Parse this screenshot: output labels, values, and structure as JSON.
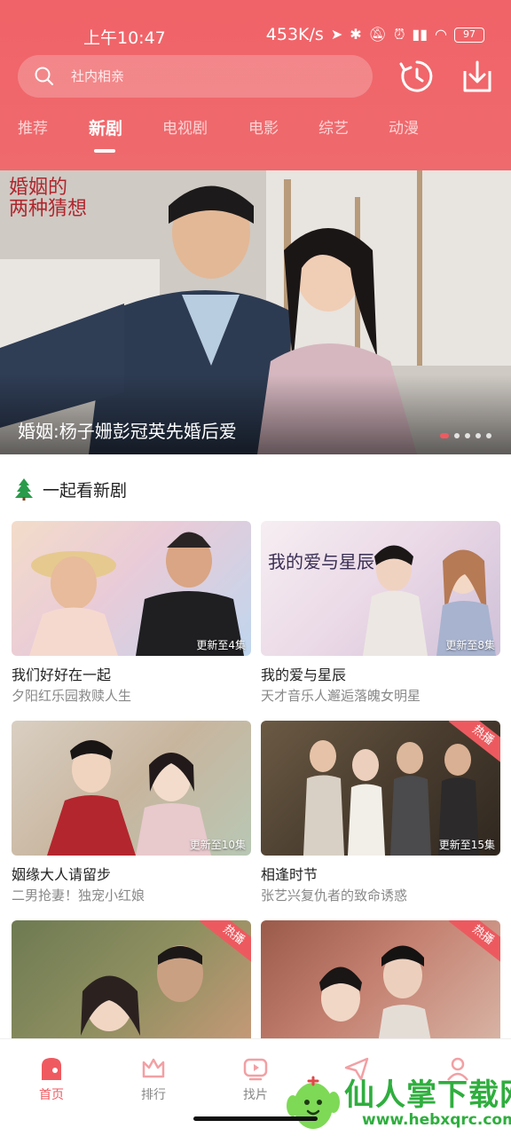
{
  "status_bar": {
    "time": "上午10:47",
    "speed": "453K/s",
    "battery": "97"
  },
  "search": {
    "placeholder": "社内相亲"
  },
  "tabs": [
    {
      "label": "推荐"
    },
    {
      "label": "新剧"
    },
    {
      "label": "电视剧"
    },
    {
      "label": "电影"
    },
    {
      "label": "综艺"
    },
    {
      "label": "动漫"
    }
  ],
  "active_tab": "新剧",
  "banner": {
    "logo_line1": "婚姻的",
    "logo_line2": "两种猜想",
    "caption": "婚姻:杨子姗彭冠英先婚后爱"
  },
  "section": {
    "title": "一起看新剧"
  },
  "cards": [
    {
      "title": "我们好好在一起",
      "subtitle": "夕阳红乐园救赎人生",
      "badge": "更新至4集"
    },
    {
      "title": "我的爱与星辰",
      "subtitle": "天才音乐人邂逅落魄女明星",
      "badge": "更新至8集",
      "poster_text": "我的爱与星辰"
    },
    {
      "title": "姻缘大人请留步",
      "subtitle": "二男抢妻！独宠小红娘",
      "badge": "更新至10集"
    },
    {
      "title": "相逢时节",
      "subtitle": "张艺兴复仇者的致命诱惑",
      "badge": "更新至15集",
      "hot": "热播"
    },
    {
      "hot": "热播"
    },
    {
      "hot": "热播"
    }
  ],
  "bottom_nav": [
    {
      "label": "首页"
    },
    {
      "label": "排行"
    },
    {
      "label": "找片"
    },
    {
      "label": ""
    },
    {
      "label": ""
    }
  ],
  "watermark": {
    "title": "仙人掌下载网",
    "url": "www.hebxqrc.com"
  },
  "colors": {
    "brand": "#ef5a60",
    "header": "#f06368",
    "watermark_green": "#2fae3e"
  }
}
